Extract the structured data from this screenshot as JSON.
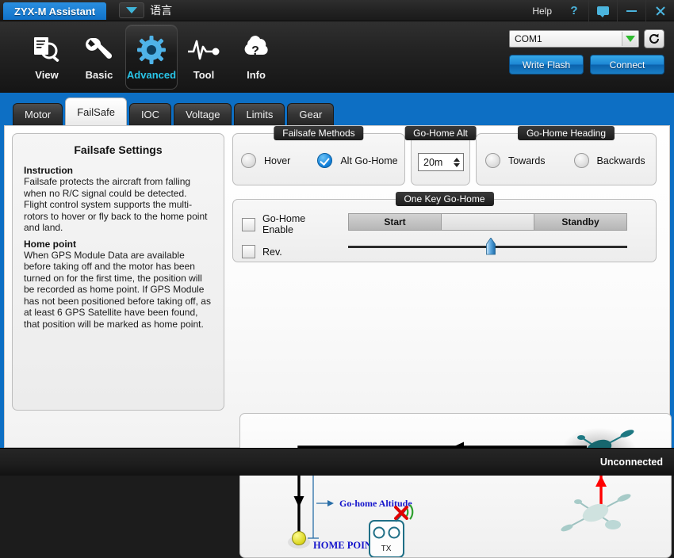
{
  "titlebar": {
    "app_title": "ZYX-M Assistant",
    "language_label": "语言",
    "help_label": "Help",
    "help_q": "?",
    "icons": {
      "lang_arrow": "chevron-down-icon",
      "chat": "chat-icon",
      "minimize": "minimize-icon",
      "close": "close-icon"
    }
  },
  "toolbar": {
    "items": [
      {
        "label": "View",
        "icon": "document-search-icon",
        "active": false
      },
      {
        "label": "Basic",
        "icon": "wrench-icon",
        "active": false
      },
      {
        "label": "Advanced",
        "icon": "gear-icon",
        "active": true
      },
      {
        "label": "Tool",
        "icon": "waveform-icon",
        "active": false
      },
      {
        "label": "Info",
        "icon": "question-cloud-icon",
        "active": false
      }
    ],
    "com_port": "COM1",
    "refresh_icon": "refresh-icon",
    "write_flash_label": "Write Flash",
    "connect_label": "Connect"
  },
  "tabs": [
    {
      "label": "Motor",
      "active": false
    },
    {
      "label": "FailSafe",
      "active": true
    },
    {
      "label": "IOC",
      "active": false
    },
    {
      "label": "Voltage",
      "active": false
    },
    {
      "label": "Limits",
      "active": false
    },
    {
      "label": "Gear",
      "active": false
    }
  ],
  "instruction": {
    "title": "Failsafe Settings",
    "section1_heading": "Instruction",
    "section1_body": "Failsafe protects the aircraft from falling when no R/C signal could be detected. Flight control system supports the multi-rotors to hover or fly back to the home point and land.",
    "section2_heading": "Home point",
    "section2_body": "When GPS Module Data are available before taking off and the motor has been turned on for the first time, the position will be recorded as home point. If GPS Module has not been positioned before taking off, as at least 6 GPS Satellite have been found, that position will be marked as home point."
  },
  "failsafe_methods": {
    "group_label": "Failsafe Methods",
    "options": [
      {
        "label": "Hover",
        "selected": false
      },
      {
        "label": "Alt Go-Home",
        "selected": true
      }
    ]
  },
  "go_home_alt": {
    "group_label": "Go-Home Alt",
    "value": "20m"
  },
  "go_home_heading": {
    "group_label": "Go-Home Heading",
    "options": [
      {
        "label": "Towards",
        "selected": false
      },
      {
        "label": "Backwards",
        "selected": false
      }
    ]
  },
  "one_key_go_home": {
    "group_label": "One Key Go-Home",
    "checkboxes": [
      {
        "label": "Go-Home Enable",
        "checked": false
      },
      {
        "label": "Rev.",
        "checked": false
      }
    ],
    "segments": [
      "Start",
      "",
      "Standby"
    ],
    "slider_percent": 51
  },
  "diagram": {
    "home_point_label": "HOME POINT",
    "go_home_altitude_label": "Go-home Altitude",
    "tx_label": "TX",
    "colors": {
      "return_path": "#ff0000",
      "descend_path": "#000000",
      "annotation": "#1414cc",
      "drone_dark": "#17676e",
      "drone_light": "#bcd8d6",
      "home_marker": "#e8e33c",
      "signal": "#2fa02f",
      "signal_cross": "#e00000"
    }
  },
  "statusbar": {
    "connection_status": "Unconnected"
  },
  "theme": {
    "accent_blue": "#0d6fc4",
    "active_tool": "#29c5e8",
    "radio_on": "#1483dd"
  }
}
